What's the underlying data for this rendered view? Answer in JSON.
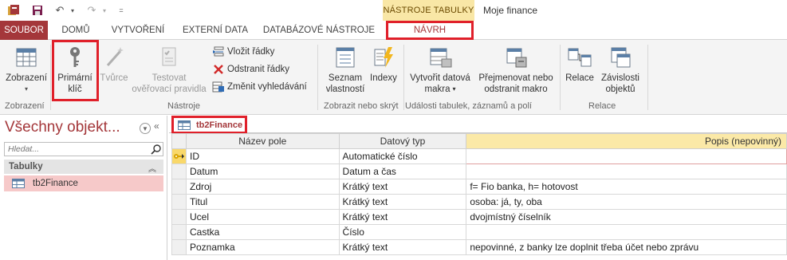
{
  "title_bar": {
    "context_tab_label": "NÁSTROJE TABULKY",
    "window_title": "Moje finance"
  },
  "ribbon_tabs": [
    {
      "label": "SOUBOR"
    },
    {
      "label": "DOMŮ"
    },
    {
      "label": "VYTVOŘENÍ"
    },
    {
      "label": "EXTERNÍ DATA"
    },
    {
      "label": "DATABÁZOVÉ NÁSTROJE"
    },
    {
      "label": "NÁVRH"
    }
  ],
  "ribbon": {
    "views": {
      "button_label": "Zobrazení",
      "group_label": "Zobrazení"
    },
    "tools": {
      "primary_key": {
        "line1": "Primární",
        "line2": "klíč"
      },
      "builder": "Tvůrce",
      "test_rules": {
        "line1": "Testovat",
        "line2": "ověřovací pravidla"
      },
      "insert_rows": "Vložit řádky",
      "delete_rows": "Odstranit řádky",
      "modify_lookups": "Změnit vyhledávání",
      "group_label": "Nástroje"
    },
    "show_hide": {
      "property_sheet": {
        "line1": "Seznam",
        "line2": "vlastností"
      },
      "indexes": "Indexy",
      "group_label": "Zobrazit nebo skrýt"
    },
    "events": {
      "create_macros": {
        "line1": "Vytvořit datová",
        "line2": "makra"
      },
      "rename_macro": {
        "line1": "Přejmenovat nebo",
        "line2": "odstranit makro"
      },
      "group_label": "Události tabulek, záznamů a polí"
    },
    "relationships": {
      "relationships": "Relace",
      "dependencies": {
        "line1": "Závislosti",
        "line2": "objektů"
      },
      "group_label": "Relace"
    }
  },
  "nav_pane": {
    "title": "Všechny objekt...",
    "search_placeholder": "Hledat...",
    "section_label": "Tabulky",
    "items": [
      {
        "label": "tb2Finance"
      }
    ]
  },
  "document": {
    "tab_label": "tb2Finance",
    "columns": [
      "Název pole",
      "Datový typ",
      "Popis (nepovinný)"
    ],
    "rows": [
      {
        "name": "ID",
        "type": "Automatické číslo",
        "desc": ""
      },
      {
        "name": "Datum",
        "type": "Datum a čas",
        "desc": ""
      },
      {
        "name": "Zdroj",
        "type": "Krátký text",
        "desc": "f= Fio banka, h= hotovost"
      },
      {
        "name": "Titul",
        "type": "Krátký text",
        "desc": "osoba: já, ty, oba"
      },
      {
        "name": "Ucel",
        "type": "Krátký text",
        "desc": "dvojmístný číselník"
      },
      {
        "name": "Castka",
        "type": "Číslo",
        "desc": ""
      },
      {
        "name": "Poznamka",
        "type": "Krátký text",
        "desc": "nepovinné, z banky lze doplnit třeba účet nebo zprávu"
      }
    ]
  },
  "colors": {
    "accent": "#a4373a",
    "highlight_box": "#e0202a",
    "context_tab": "#f9e7a6",
    "selected_item": "#f6c9c9"
  }
}
